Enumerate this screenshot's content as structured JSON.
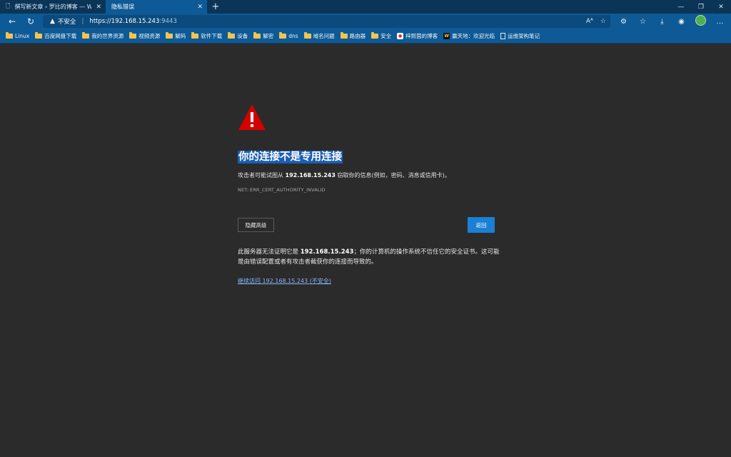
{
  "browser": {
    "tabs": [
      {
        "label": "撰写新文章 › 罗比的博客 — Wor",
        "active": false
      },
      {
        "label": "隐私错误",
        "active": true
      }
    ],
    "address": {
      "security_label": "不安全",
      "url_host": "https://192.168.15.243",
      "url_port": ":9443"
    },
    "bookmarks": [
      {
        "label": "Linux",
        "icon": "folder-icon"
      },
      {
        "label": "百度网盘下载",
        "icon": "folder-icon"
      },
      {
        "label": "我的世界资源",
        "icon": "folder-icon"
      },
      {
        "label": "视频资源",
        "icon": "folder-icon"
      },
      {
        "label": "解码",
        "icon": "folder-icon"
      },
      {
        "label": "软件下载",
        "icon": "folder-icon"
      },
      {
        "label": "设备",
        "icon": "folder-icon"
      },
      {
        "label": "解密",
        "icon": "folder-icon"
      },
      {
        "label": "dns",
        "icon": "folder-icon"
      },
      {
        "label": "域名问题",
        "icon": "folder-icon"
      },
      {
        "label": "路由器",
        "icon": "folder-icon"
      },
      {
        "label": "安全",
        "icon": "folder-icon"
      },
      {
        "label": "梓熙茵的博客",
        "icon": "site-favicon-red"
      },
      {
        "label": "赢天地：欢迎光临",
        "icon": "site-favicon-w"
      },
      {
        "label": "运维架构笔记",
        "icon": "page-icon"
      }
    ]
  },
  "error_page": {
    "title": "你的连接不是专用连接",
    "desc_prefix": "攻击者可能试图从 ",
    "host": "192.168.15.243",
    "desc_suffix": " 窃取你的信息(例如，密码、消息或信用卡)。",
    "error_code": "NET::ERR_CERT_AUTHORITY_INVALID",
    "advanced_button": "隐藏高级",
    "back_button": "返回",
    "detail_prefix": "此服务器无法证明它是 ",
    "detail_suffix": "；你的计算机的操作系统不信任它的安全证书。这可能是由错误配置或者有攻击者截获你的连接而导致的。",
    "proceed_link": "继续访问 192.168.15.243 (不安全)"
  },
  "colors": {
    "titlebar": "#0b3557",
    "toolbar": "#0e5a96",
    "page_bg": "#2b2b2b",
    "warning_red": "#d40000",
    "primary_button": "#1a80d6",
    "link": "#8ab4f8"
  }
}
